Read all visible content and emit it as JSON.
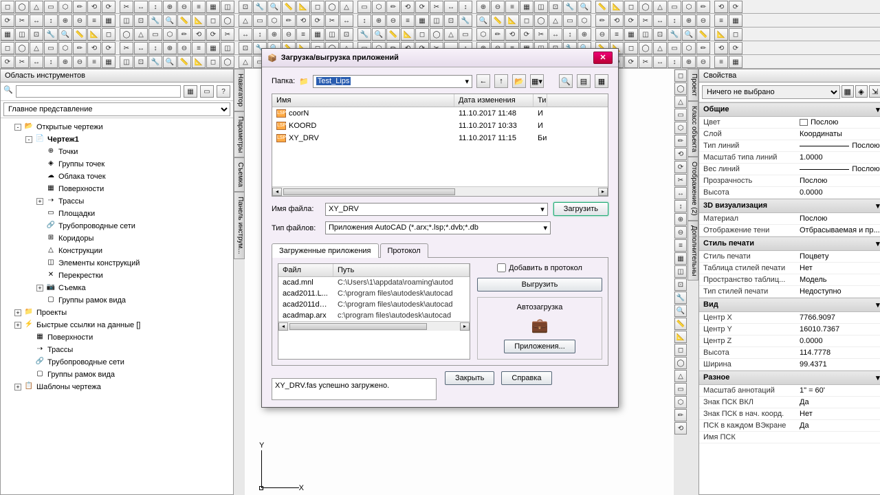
{
  "toolbars": {
    "rows": 5
  },
  "left_panel": {
    "title": "Область инструментов",
    "view_combo": "Главное представление",
    "tree": [
      {
        "level": 1,
        "exp": "-",
        "icon": "📂",
        "label": "Открытые чертежи"
      },
      {
        "level": 2,
        "exp": "-",
        "icon": "📄",
        "label": "Чертеж1",
        "bold": true
      },
      {
        "level": 3,
        "exp": "",
        "icon": "⊕",
        "label": "Точки"
      },
      {
        "level": 3,
        "exp": "",
        "icon": "◈",
        "label": "Группы точек"
      },
      {
        "level": 3,
        "exp": "",
        "icon": "☁",
        "label": "Облака точек"
      },
      {
        "level": 3,
        "exp": "",
        "icon": "▦",
        "label": "Поверхности"
      },
      {
        "level": 3,
        "exp": "+",
        "icon": "⇢",
        "label": "Трассы"
      },
      {
        "level": 3,
        "exp": "",
        "icon": "▭",
        "label": "Площадки"
      },
      {
        "level": 3,
        "exp": "",
        "icon": "🔗",
        "label": "Трубопроводные сети"
      },
      {
        "level": 3,
        "exp": "",
        "icon": "⊞",
        "label": "Коридоры"
      },
      {
        "level": 3,
        "exp": "",
        "icon": "△",
        "label": "Конструкции"
      },
      {
        "level": 3,
        "exp": "",
        "icon": "◫",
        "label": "Элементы конструкций"
      },
      {
        "level": 3,
        "exp": "",
        "icon": "✕",
        "label": "Перекрестки"
      },
      {
        "level": 3,
        "exp": "+",
        "icon": "📷",
        "label": "Съемка"
      },
      {
        "level": 3,
        "exp": "",
        "icon": "▢",
        "label": "Группы рамок вида"
      },
      {
        "level": 1,
        "exp": "+",
        "icon": "📁",
        "label": "Проекты"
      },
      {
        "level": 1,
        "exp": "+",
        "icon": "⚡",
        "label": "Быстрые ссылки на данные []"
      },
      {
        "level": 2,
        "exp": "",
        "icon": "▦",
        "label": "Поверхности"
      },
      {
        "level": 2,
        "exp": "",
        "icon": "⇢",
        "label": "Трассы"
      },
      {
        "level": 2,
        "exp": "",
        "icon": "🔗",
        "label": "Трубопроводные сети"
      },
      {
        "level": 2,
        "exp": "",
        "icon": "▢",
        "label": "Группы рамок вида"
      },
      {
        "level": 1,
        "exp": "+",
        "icon": "📋",
        "label": "Шаблоны чертежа"
      }
    ]
  },
  "vert_tabs": [
    "Навигатор",
    "Параметры",
    "Съемка",
    "Панель инструм..."
  ],
  "right_vert_tabs": [
    "Проект",
    "Класс объекта",
    "Отображение (2)",
    "Дополнительны"
  ],
  "props": {
    "title": "Свойства",
    "selector": "Ничего не выбрано",
    "sections": [
      {
        "name": "Общие",
        "rows": [
          {
            "l": "Цвет",
            "v": "Послою",
            "swatch": "white"
          },
          {
            "l": "Слой",
            "v": "Координаты"
          },
          {
            "l": "Тип линий",
            "v": "Послою",
            "line": true
          },
          {
            "l": "Масштаб типа линий",
            "v": "1.0000"
          },
          {
            "l": "Вес линий",
            "v": "Послою",
            "line": true
          },
          {
            "l": "Прозрачность",
            "v": "Послою"
          },
          {
            "l": "Высота",
            "v": "0.0000"
          }
        ]
      },
      {
        "name": "3D визуализация",
        "rows": [
          {
            "l": "Материал",
            "v": "Послою"
          },
          {
            "l": "Отображение тени",
            "v": "Отбрасываемая и пр..."
          }
        ]
      },
      {
        "name": "Стиль печати",
        "rows": [
          {
            "l": "Стиль печати",
            "v": "Поцвету"
          },
          {
            "l": "Таблица стилей печати",
            "v": "Нет"
          },
          {
            "l": "Пространство таблиц...",
            "v": "Модель"
          },
          {
            "l": "Тип стилей печати",
            "v": "Недоступно"
          }
        ]
      },
      {
        "name": "Вид",
        "rows": [
          {
            "l": "Центр X",
            "v": "7766.9097"
          },
          {
            "l": "Центр Y",
            "v": "16010.7367"
          },
          {
            "l": "Центр Z",
            "v": "0.0000"
          },
          {
            "l": "Высота",
            "v": "114.7778"
          },
          {
            "l": "Ширина",
            "v": "99.4371"
          }
        ]
      },
      {
        "name": "Разное",
        "rows": [
          {
            "l": "Масштаб аннотаций",
            "v": "1\" = 60'"
          },
          {
            "l": "Знак ПСК ВКЛ",
            "v": "Да"
          },
          {
            "l": "Знак ПСК в нач. коорд.",
            "v": "Нет"
          },
          {
            "l": "ПСК в каждом ВЭкране",
            "v": "Да"
          },
          {
            "l": "Имя ПСК",
            "v": ""
          }
        ]
      }
    ]
  },
  "dialog": {
    "title": "Загрузка/выгрузка приложений",
    "folder_label": "Папка:",
    "folder_value": "Test_Lips",
    "columns": {
      "name": "Имя",
      "date": "Дата изменения",
      "type": "Ти"
    },
    "files": [
      {
        "name": "coorN",
        "date": "11.10.2017 11:48",
        "type": "И"
      },
      {
        "name": "KOORD",
        "date": "11.10.2017 10:33",
        "type": "И"
      },
      {
        "name": "XY_DRV",
        "date": "11.10.2017 11:15",
        "type": "Би"
      }
    ],
    "filename_label": "Имя файла:",
    "filename_value": "XY_DRV",
    "filetype_label": "Тип файлов:",
    "filetype_value": "Приложения AutoCAD (*.arx;*.lsp;*.dvb;*.db",
    "load_btn": "Загрузить",
    "tab1": "Загруженные приложения",
    "tab2": "Протокол",
    "add_log": "Добавить в протокол",
    "unload_btn": "Выгрузить",
    "autostart": "Автозагрузка",
    "apps_btn": "Приложения...",
    "loaded_cols": {
      "file": "Файл",
      "path": "Путь"
    },
    "loaded": [
      {
        "f": "acad.mnl",
        "p": "C:\\Users\\1\\appdata\\roaming\\autod"
      },
      {
        "f": "acad2011.L...",
        "p": "C:\\program files\\autodesk\\autocad "
      },
      {
        "f": "acad2011do...",
        "p": "C:\\program files\\autodesk\\autocad "
      },
      {
        "f": "acadmap.arx",
        "p": "c:\\program files\\autodesk\\autocad "
      }
    ],
    "status": "XY_DRV.fas успешно загружено.",
    "close_btn": "Закрыть",
    "help_btn": "Справка"
  }
}
